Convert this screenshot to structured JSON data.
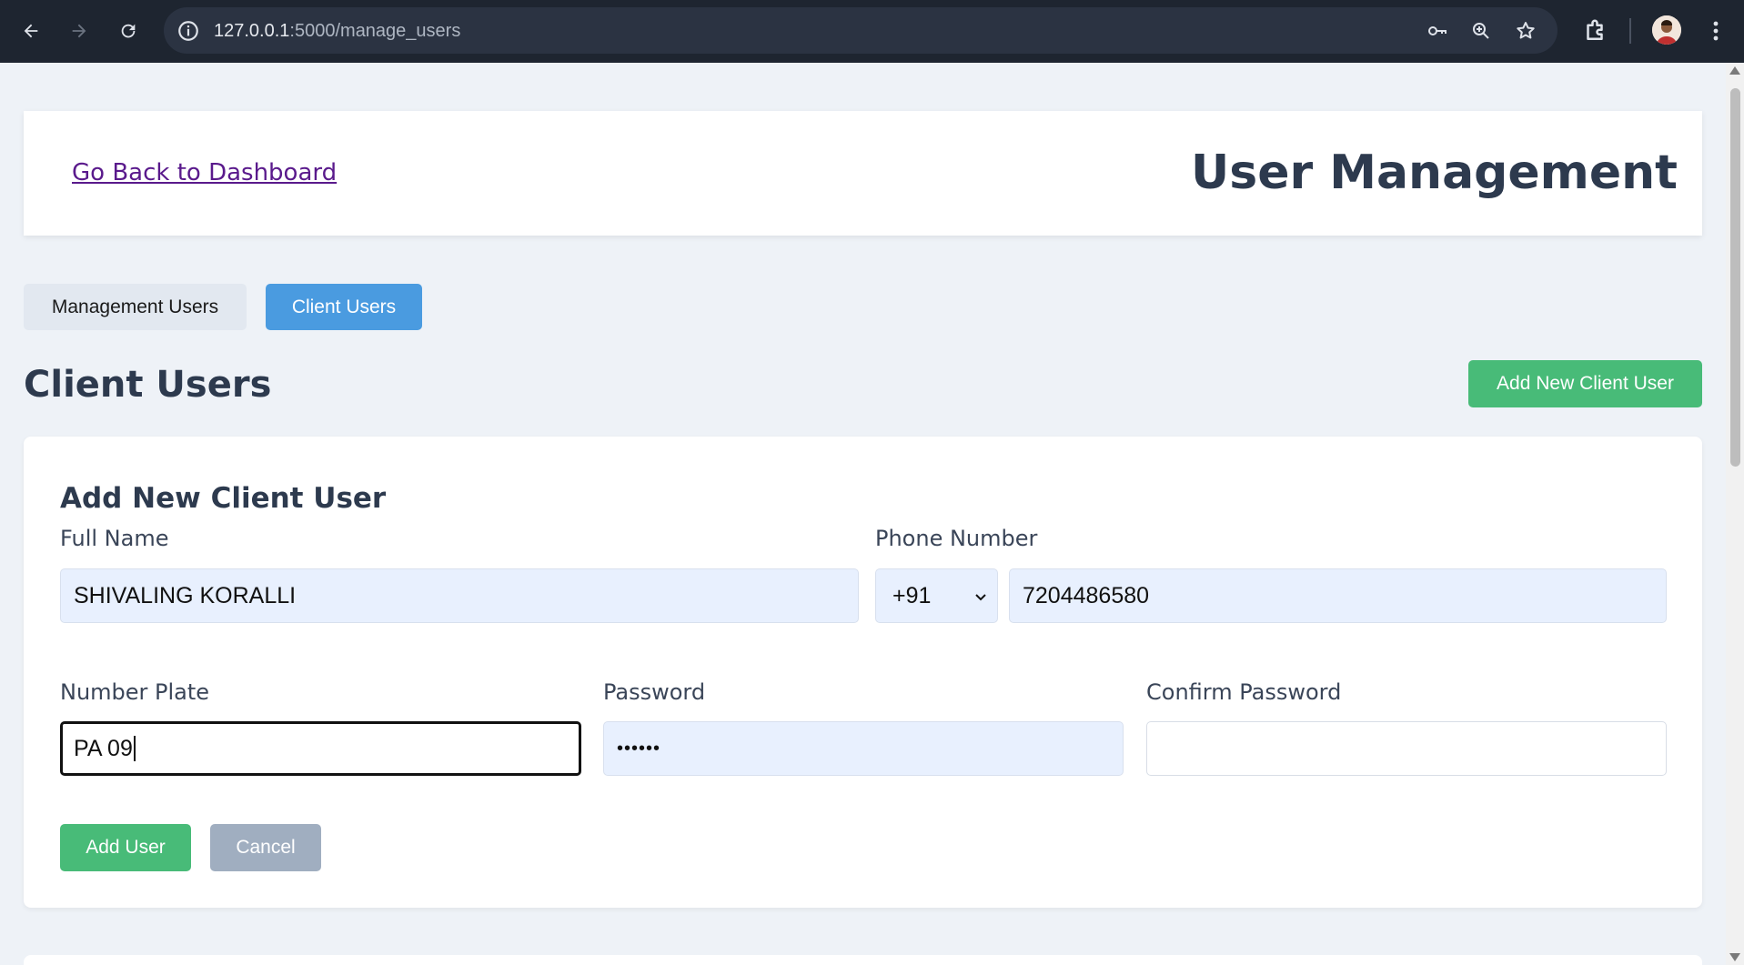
{
  "browser": {
    "url_host": "127.0.0.1",
    "url_path": ":5000/manage_users",
    "icons": [
      "back-arrow-icon",
      "forward-arrow-icon",
      "reload-icon",
      "site-info-icon",
      "key-icon",
      "zoom-icon",
      "bookmark-star-icon",
      "extensions-icon",
      "profile-avatar",
      "menu-dots-icon"
    ]
  },
  "header": {
    "back_link": "Go Back to Dashboard",
    "title": "User Management"
  },
  "tabs": [
    {
      "label": "Management Users",
      "active": false
    },
    {
      "label": "Client Users",
      "active": true
    }
  ],
  "section": {
    "title": "Client Users",
    "add_button": "Add New Client User"
  },
  "form": {
    "title": "Add New Client User",
    "full_name": {
      "label": "Full Name",
      "value": "SHIVALING KORALLI"
    },
    "phone": {
      "label": "Phone Number",
      "country_code": "+91",
      "value": "7204486580"
    },
    "number_plate": {
      "label": "Number Plate",
      "value": "PA 09"
    },
    "password": {
      "label": "Password",
      "value": "••••••"
    },
    "confirm_password": {
      "label": "Confirm Password",
      "value": ""
    },
    "submit_label": "Add User",
    "cancel_label": "Cancel"
  },
  "colors": {
    "primary_blue": "#4a9be0",
    "success_green": "#48bb78",
    "cancel_gray": "#a0aec0",
    "heading": "#2d3a4e",
    "page_bg": "#eef2f7"
  }
}
